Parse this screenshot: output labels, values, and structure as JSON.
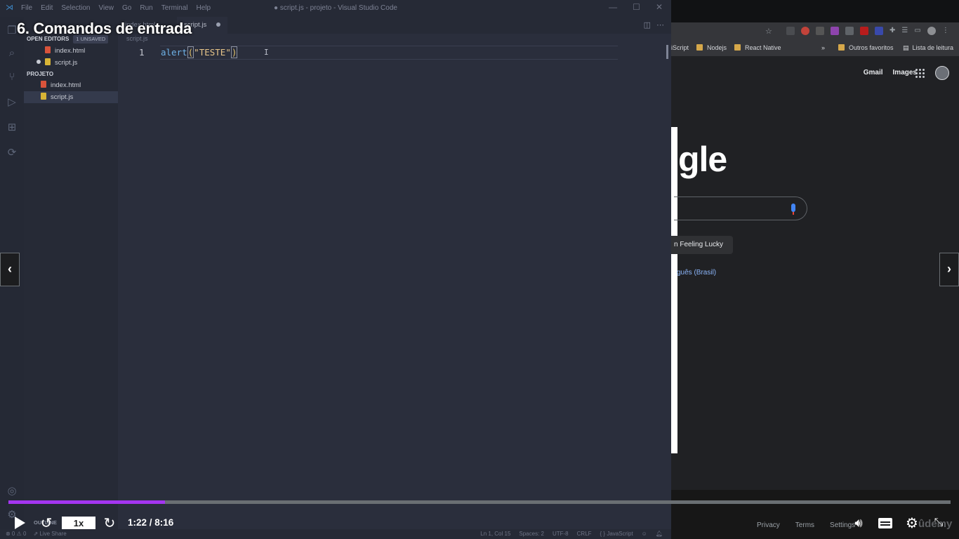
{
  "vscode": {
    "menu": [
      "File",
      "Edit",
      "Selection",
      "View",
      "Go",
      "Run",
      "Terminal",
      "Help"
    ],
    "window_title": "● script.js - projeto - Visual Studio Code",
    "sidebar": {
      "open_editors_label": "OPEN EDITORS",
      "unsaved_badge": "1 UNSAVED",
      "open_editors": [
        {
          "name": "index.html",
          "type": "html"
        },
        {
          "name": "script.js",
          "type": "js",
          "unsaved": true
        }
      ],
      "project_label": "PROJETO",
      "project_files": [
        {
          "name": "index.html",
          "type": "html"
        },
        {
          "name": "script.js",
          "type": "js"
        }
      ]
    },
    "tabs": [
      {
        "label": "index.html"
      },
      {
        "label": "script.js",
        "active": true,
        "unsaved": true
      }
    ],
    "breadcrumb": "script.js",
    "editor": {
      "line_number": "1",
      "code_fn": "alert",
      "code_open": "(",
      "code_str": "\"TESTE\"",
      "code_close": ")"
    },
    "status_bar": {
      "errors": "⊗ 0 ⚠ 0",
      "live_share": "Live Share",
      "cursor_position": "Ln 1, Col 15",
      "spaces": "Spaces: 2",
      "encoding": "UTF-8",
      "line_ending": "CRLF",
      "language": "{ } JavaScript"
    },
    "outline_label": "OUTLINE"
  },
  "browser": {
    "bookmarks": [
      "Nodejs",
      "React Native",
      "Outros favoritos",
      "Lista de leitura"
    ],
    "bookmark_cut": "iScript",
    "bookmark_more": "»",
    "gmail_link": "Gmail",
    "images_link": "Images",
    "logo_fragment": "gle",
    "lucky_button": "n Feeling Lucky",
    "language_link": "guês (Brasil)",
    "footer_links": [
      "Privacy",
      "Terms",
      "Settings"
    ]
  },
  "player": {
    "lecture_title": "6. Comandos de entrada",
    "speed": "1x",
    "time": "1:22 / 8:16",
    "progress": 0.166,
    "prev_label": "‹",
    "next_label": "›",
    "watermark": "ûdemy"
  },
  "colors": {
    "progress_fill": "#a435f0",
    "progress_track": "#6a6f73",
    "editor_bg": "#2a2e3c",
    "sidebar_bg": "#262a36"
  }
}
